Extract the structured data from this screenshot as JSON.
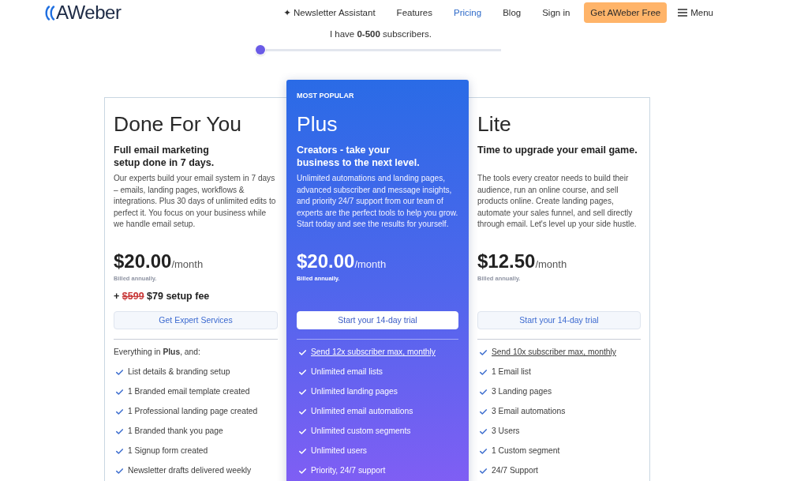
{
  "header": {
    "logo": "AWeber",
    "nav": [
      {
        "label": "✦ Newsletter Assistant",
        "selected": false
      },
      {
        "label": "Features",
        "selected": false
      },
      {
        "label": "Pricing",
        "selected": true
      },
      {
        "label": "Blog",
        "selected": false
      },
      {
        "label": "Sign in",
        "selected": false
      }
    ],
    "cta_button": "Get AWeber Free",
    "menu": "Menu"
  },
  "subscriber_slider": {
    "label": "I have **0-500** subscribers.",
    "level": 0
  },
  "plans": [
    {
      "name": "Done For You",
      "featured": false,
      "tagline": "Full email marketing\nsetup done in **7 days.**",
      "description": "Our experts build your email system in 7 days – emails, landing pages, workflows & integrations. Plus 30 days of unlimited edits to perfect it. You focus on your business while we handle email setup.",
      "price": "$20.00",
      "period": "/month",
      "billing": "Billed annually.",
      "setup_fee": {
        "prefix": "+",
        "old_price": "$599",
        "text": "$79 setup fee"
      },
      "button": "Get Expert Services",
      "features_intro": "Everything in **Plus**, and:",
      "features": [
        {
          "kind": "plain",
          "text": "List details & branding setup"
        },
        {
          "kind": "plain",
          "text": "1 Branded email template created"
        },
        {
          "kind": "plain",
          "text": "1 Professional landing page created"
        },
        {
          "kind": "plain",
          "text": "1 Branded thank you page"
        },
        {
          "kind": "plain",
          "text": "1 Signup form created"
        },
        {
          "kind": "plain",
          "text": "Newsletter drafts delivered weekly"
        }
      ]
    },
    {
      "name": "Plus",
      "featured": true,
      "badge": "MOST POPULAR",
      "tagline": "Creators - take your\nbusiness to the next level.",
      "description": "Unlimited automations and landing pages, advanced subscriber and message insights, and priority 24/7 support from our team of experts are the perfect tools to help you grow. Start today and see the results for yourself.",
      "price": "$20.00",
      "period": "/month",
      "billing": "Billed annually.",
      "button": "Start your 14-day trial",
      "features": [
        {
          "kind": "link",
          "text": "Send 12x subscriber max, monthly"
        },
        {
          "kind": "plain",
          "text": "Unlimited email lists"
        },
        {
          "kind": "plain",
          "text": "Unlimited landing pages"
        },
        {
          "kind": "plain",
          "text": "Unlimited email automations"
        },
        {
          "kind": "plain",
          "text": "Unlimited custom segments"
        },
        {
          "kind": "plain",
          "text": "Unlimited users"
        },
        {
          "kind": "plain",
          "text": "Priority, 24/7 support"
        }
      ]
    },
    {
      "name": "Lite",
      "featured": false,
      "tagline": "Time to upgrade your email game.",
      "description": "The tools every creator needs to build their audience, run an online course, and sell products online. Create landing pages, automate your sales funnel, and sell directly through email. Let's level up your side hustle.",
      "price": "$12.50",
      "period": "/month",
      "billing": "Billed annually.",
      "button": "Start your 14-day trial",
      "features": [
        {
          "kind": "link",
          "text": "Send 10x subscriber max, monthly"
        },
        {
          "kind": "plain",
          "text": "1 Email list"
        },
        {
          "kind": "plain",
          "text": "3 Landing pages"
        },
        {
          "kind": "plain",
          "text": "3 Email automations"
        },
        {
          "kind": "plain",
          "text": "3 Users"
        },
        {
          "kind": "plain",
          "text": "1 Custom segment"
        },
        {
          "kind": "plain",
          "text": "24/7 Support"
        }
      ]
    }
  ]
}
